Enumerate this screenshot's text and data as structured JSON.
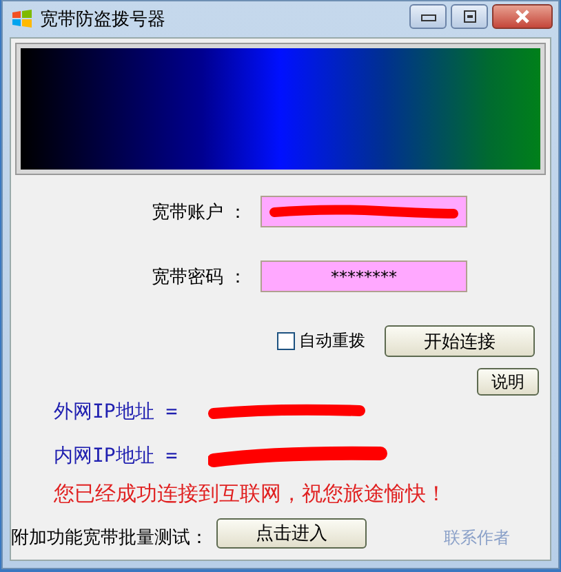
{
  "window": {
    "title": "宽带防盗拨号器"
  },
  "account": {
    "label": "宽带账户 ：",
    "redacted": true
  },
  "password": {
    "label": "宽带密码 ：",
    "value": "********"
  },
  "auto_redial": {
    "label": "自动重拨",
    "checked": false
  },
  "connect_button": "开始连接",
  "help_button": "说明",
  "external_ip": {
    "label": "外网IP地址 =",
    "redacted": true
  },
  "internal_ip": {
    "label": "内网IP地址 =",
    "redacted": true
  },
  "status_message": "您已经成功连接到互联网，祝您旅途愉快！",
  "batch_test": {
    "label": "附加功能宽带批量测试：",
    "button": "点击进入"
  },
  "contact_link": "联系作者"
}
